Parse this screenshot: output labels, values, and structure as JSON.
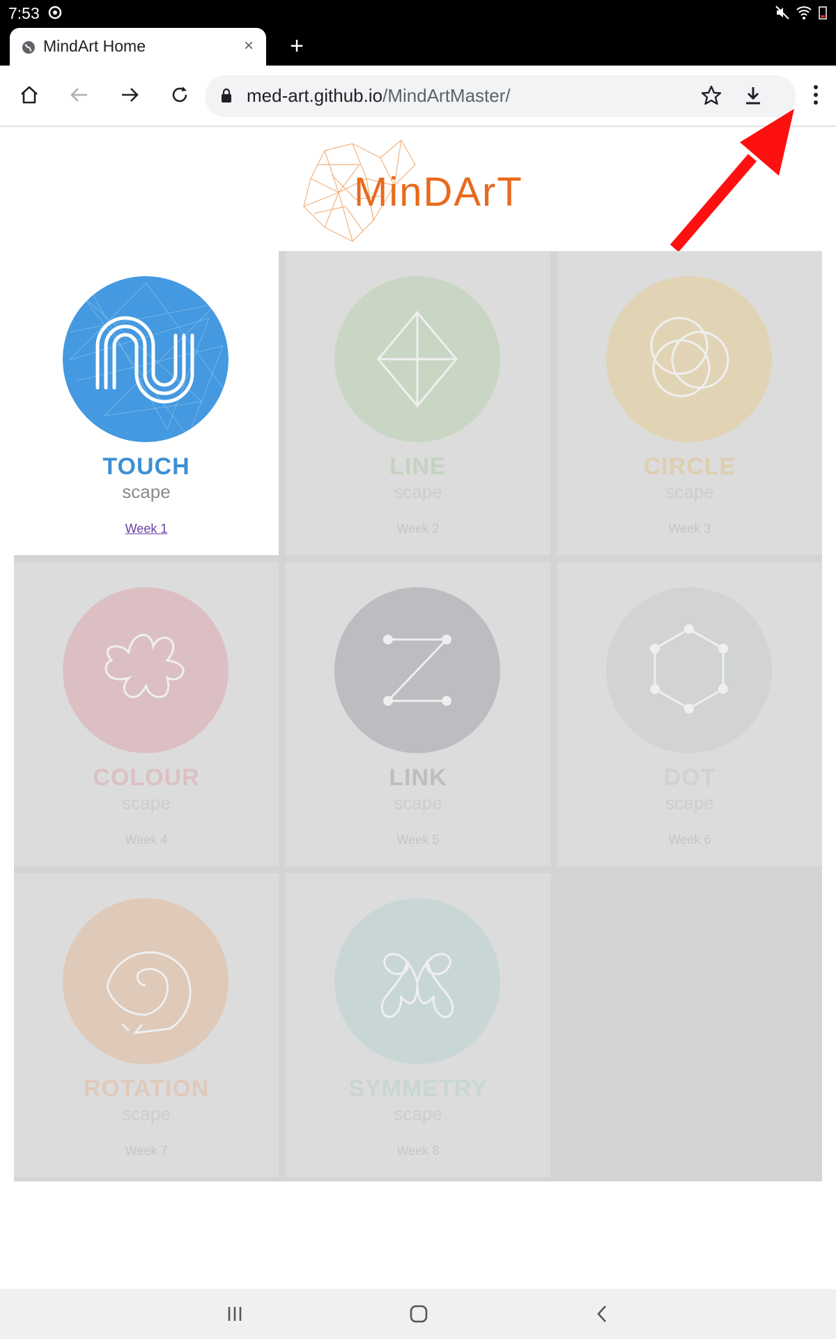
{
  "status": {
    "time": "7:53"
  },
  "tab": {
    "title": "MindArt Home",
    "close": "×",
    "new_tab": "+"
  },
  "omnibox": {
    "domain": "med-art.github.io",
    "path": "/MindArtMaster/"
  },
  "logo": {
    "text": "MinDArT"
  },
  "cards": [
    {
      "name": "TOUCH",
      "sub": "scape",
      "week": "Week 1",
      "color": "#4499e0",
      "text_color": "#3d8fd6"
    },
    {
      "name": "LINE",
      "sub": "scape",
      "week": "Week 2",
      "color": "#b8d2b0",
      "text_color": "#a8c8a0"
    },
    {
      "name": "CIRCLE",
      "sub": "scape",
      "week": "Week 3",
      "color": "#e6cf96",
      "text_color": "#e0c07a"
    },
    {
      "name": "COLOUR",
      "sub": "scape",
      "week": "Week 4",
      "color": "#dda8b0",
      "text_color": "#dda0a8"
    },
    {
      "name": "LINK",
      "sub": "scape",
      "week": "Week 5",
      "color": "#a2a3ab",
      "text_color": "#9a9ba3"
    },
    {
      "name": "DOT",
      "sub": "scape",
      "week": "Week 6",
      "color": "#c9ccd0",
      "text_color": "#c2c5c9"
    },
    {
      "name": "ROTATION",
      "sub": "scape",
      "week": "Week 7",
      "color": "#e3ba9c",
      "text_color": "#e3b492"
    },
    {
      "name": "SYMMETRY",
      "sub": "scape",
      "week": "Week 8",
      "color": "#b8d4d2",
      "text_color": "#b0cfcc"
    }
  ],
  "colors": {
    "accent_arrow": "#ff1010",
    "logo_orange": "#e86a1d"
  }
}
